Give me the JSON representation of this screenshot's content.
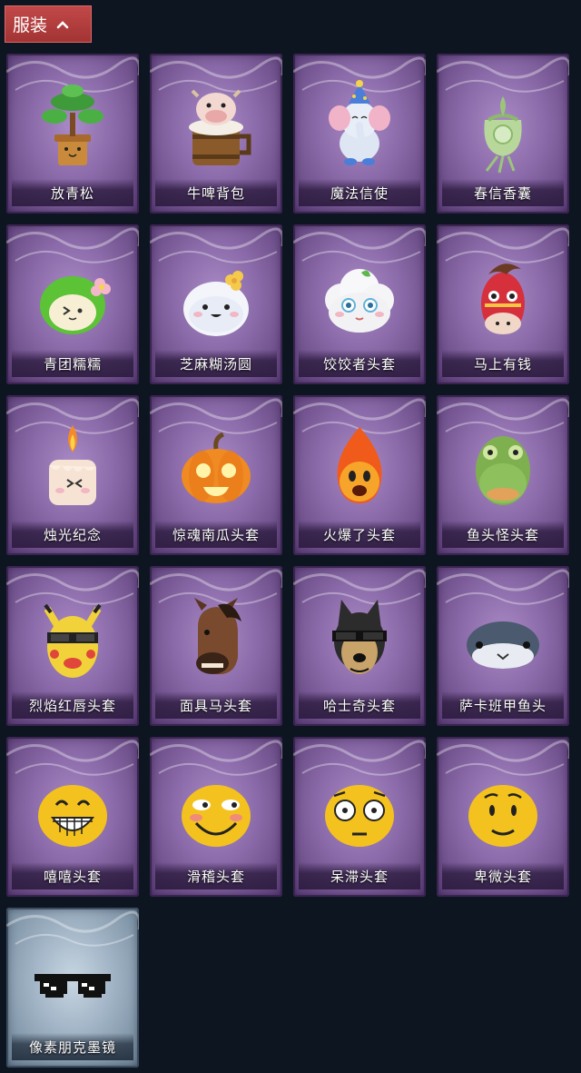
{
  "header": {
    "title": "服装",
    "toggle_icon": "chevron-up-icon"
  },
  "items": [
    {
      "name": "放青松",
      "icon": "bonsai-pine-icon",
      "rarity": "purple"
    },
    {
      "name": "牛啤背包",
      "icon": "cow-beer-barrel-icon",
      "rarity": "purple"
    },
    {
      "name": "魔法信使",
      "icon": "elephant-messenger-icon",
      "rarity": "purple"
    },
    {
      "name": "春信香囊",
      "icon": "sachet-icon",
      "rarity": "purple"
    },
    {
      "name": "青团糯糯",
      "icon": "green-rice-ball-icon",
      "rarity": "purple"
    },
    {
      "name": "芝麻糊汤圆",
      "icon": "white-dumpling-icon",
      "rarity": "purple"
    },
    {
      "name": "饺饺者头套",
      "icon": "dumpling-cloud-mask-icon",
      "rarity": "purple"
    },
    {
      "name": "马上有钱",
      "icon": "red-horse-mask-icon",
      "rarity": "purple"
    },
    {
      "name": "烛光纪念",
      "icon": "candle-icon",
      "rarity": "purple"
    },
    {
      "name": "惊魂南瓜头套",
      "icon": "pumpkin-mask-icon",
      "rarity": "purple"
    },
    {
      "name": "火爆了头套",
      "icon": "fire-mask-icon",
      "rarity": "purple"
    },
    {
      "name": "鱼头怪头套",
      "icon": "fish-head-mask-icon",
      "rarity": "purple"
    },
    {
      "name": "烈焰红唇头套",
      "icon": "yellow-mask-sunglasses-icon",
      "rarity": "purple"
    },
    {
      "name": "面具马头套",
      "icon": "horse-mask-icon",
      "rarity": "purple"
    },
    {
      "name": "哈士奇头套",
      "icon": "husky-mask-icon",
      "rarity": "purple"
    },
    {
      "name": "萨卡班甲鱼头",
      "icon": "sacabambaspis-head-icon",
      "rarity": "purple"
    },
    {
      "name": "嘻嘻头套",
      "icon": "grin-emoji-mask-icon",
      "rarity": "purple"
    },
    {
      "name": "滑稽头套",
      "icon": "funny-emoji-mask-icon",
      "rarity": "purple"
    },
    {
      "name": "呆滞头套",
      "icon": "dazed-emoji-mask-icon",
      "rarity": "purple"
    },
    {
      "name": "卑微头套",
      "icon": "humble-emoji-mask-icon",
      "rarity": "purple"
    },
    {
      "name": "像素朋克墨镜",
      "icon": "pixel-sunglasses-icon",
      "rarity": "blue"
    }
  ],
  "colors": {
    "background": "#0d1521",
    "header": "#b03c3c",
    "purple_card": "#8a6aa8",
    "blue_card": "#9fb2c4"
  }
}
